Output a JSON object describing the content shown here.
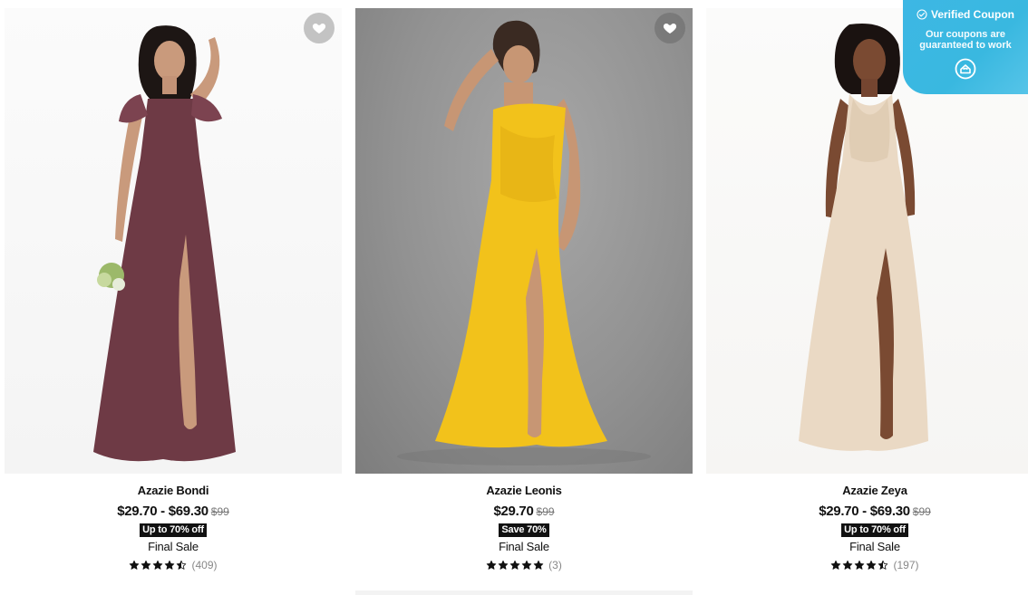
{
  "products": [
    {
      "name": "Azazie Bondi",
      "price": "$29.70 - $69.30",
      "original_price": "$99",
      "badge": "Up to 70% off",
      "sale_label": "Final Sale",
      "rating": 4.5,
      "reviews": "(409)",
      "dress_color": "#6e3a45",
      "wishlist_icon": "heart-icon"
    },
    {
      "name": "Azazie Leonis",
      "price": "$29.70",
      "original_price": "$99",
      "badge": "Save 70%",
      "sale_label": "Final Sale",
      "rating": 5,
      "reviews": "(3)",
      "dress_color": "#f2c21b",
      "wishlist_icon": "heart-icon"
    },
    {
      "name": "Azazie Zeya",
      "price": "$29.70 - $69.30",
      "original_price": "$99",
      "badge": "Up to 70% off",
      "sale_label": "Final Sale",
      "rating": 4.5,
      "reviews": "(197)",
      "dress_color": "#ead9c4",
      "wishlist_icon": "heart-icon"
    }
  ],
  "coupon_widget": {
    "title": "Verified Coupon",
    "subtitle_line1": "Our coupons are",
    "subtitle_line2": "guaranteed to work",
    "icon": "check-circle-icon",
    "logo_icon": "brand-logo-icon",
    "color": "#3db7e4"
  }
}
